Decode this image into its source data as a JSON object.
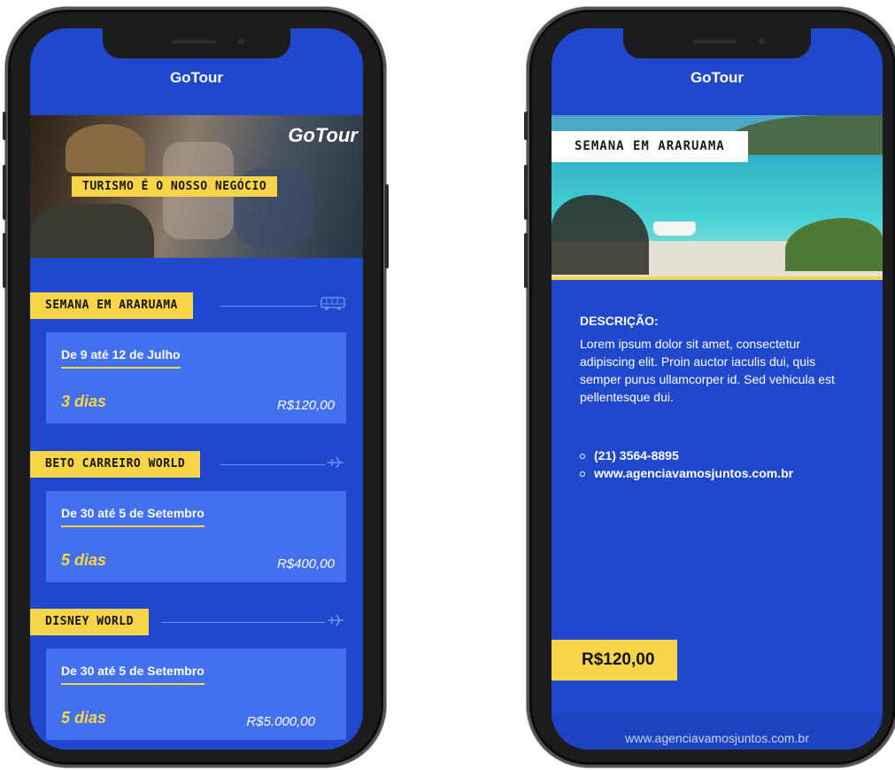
{
  "left_phone": {
    "app_title": "GoTour",
    "hero_logo": "GoTour",
    "hero_tagline": "TURISMO É O NOSSO NEGÓCIO",
    "tours": [
      {
        "name": "SEMANA EM ARARUAMA",
        "icon": "bus-icon",
        "dates": "De 9 até 12 de Julho",
        "days": "3 dias",
        "price": "R$120,00"
      },
      {
        "name": "BETO CARREIRO WORLD",
        "icon": "airplane-icon",
        "dates": "De 30 até 5 de Setembro",
        "days": "5 dias",
        "price": "R$400,00"
      },
      {
        "name": "DISNEY WORLD",
        "icon": "airplane-icon",
        "dates": "De 30 até 5 de Setembro",
        "days": "5 dias",
        "price": "R$5.000,00"
      }
    ]
  },
  "right_phone": {
    "app_title": "GoTour",
    "hero_title": "SEMANA EM ARARUAMA",
    "description_heading": "DESCRIÇÃO:",
    "description_text": "Lorem ipsum dolor sit amet, consectetur adipiscing elit. Proin auctor iaculis dui, quis semper purus ullamcorper id. Sed vehicula est pellentesque dui.",
    "phone": "(21) 3564-8895",
    "website": "www.agenciavamosjuntos.com.br",
    "price": "R$120,00",
    "footer_url": "www.agenciavamosjuntos.com.br"
  },
  "colors": {
    "brand_blue": "#1f48cc",
    "card_blue": "#4270ee",
    "accent_yellow": "#f8d448"
  }
}
